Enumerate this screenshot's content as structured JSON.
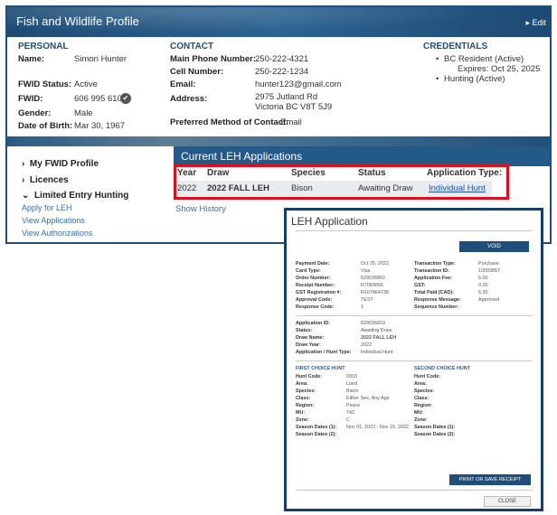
{
  "profile": {
    "title": "Fish and Wildlife Profile",
    "edit_label": "▸ Edit",
    "personal": {
      "heading": "PERSONAL",
      "name_label": "Name:",
      "name": "Simon Hunter",
      "fwid_status_label": "FWID Status:",
      "fwid_status": "Active",
      "fwid_label": "FWID:",
      "fwid": "606 995 610",
      "gender_label": "Gender:",
      "gender": "Male",
      "dob_label": "Date of Birth:",
      "dob": "Mar 30, 1967"
    },
    "contact": {
      "heading": "CONTACT",
      "main_phone_label": "Main Phone Number:",
      "main_phone": "250-222-4321",
      "cell_label": "Cell Number:",
      "cell": "250-222-1234",
      "email_label": "Email:",
      "email": "hunter123@gmail.com",
      "address_label": "Address:",
      "address_line1": "2975 Jutland Rd",
      "address_line2": "Victoria BC V8T 5J9",
      "preferred_label": "Preferred Method of Contact:",
      "preferred": "Email"
    },
    "credentials": {
      "heading": "CREDENTIALS",
      "item1": "BC Resident (Active)",
      "item1_expiry": "Expires: Oct 25, 2025",
      "item2": "Hunting (Active)"
    }
  },
  "nav": {
    "my_profile": "My FWID Profile",
    "licences": "Licences",
    "leh": "Limited Entry Hunting",
    "apply": "Apply for LEH",
    "view_apps": "View Applications",
    "view_auth": "View Authorizations"
  },
  "leh_table": {
    "heading": "Current LEH Applications",
    "headers": {
      "year": "Year",
      "draw": "Draw",
      "species": "Species",
      "status": "Status",
      "app_type": "Application Type:"
    },
    "row": {
      "year": "2022",
      "draw": "2022 FALL LEH",
      "species": "Bison",
      "status": "Awaiting Draw",
      "app_type": "Individual Hunt"
    },
    "show_history": "Show History"
  },
  "modal": {
    "title": "LEH Application",
    "void": "VOID",
    "payment": {
      "payment_date_label": "Payment Date:",
      "payment_date": "Oct 25, 2022",
      "card_type_label": "Card Type:",
      "card_type": "Visa",
      "order_number_label": "Order Number:",
      "order_number": "629036852",
      "receipt_number_label": "Receipt Number:",
      "receipt_number": "R7083856",
      "gst_reg_label": "GST Registration #:",
      "gst_reg": "R107864738",
      "approval_code_label": "Approval Code:",
      "approval_code": "TEST",
      "response_code_label": "Response Code:",
      "response_code": "1",
      "transaction_type_label": "Transaction Type:",
      "transaction_type": "Purchase",
      "transaction_id_label": "Transaction ID:",
      "transaction_id": "10003857",
      "application_fee_label": "Application Fee:",
      "application_fee": "6.00",
      "gst_label": "GST:",
      "gst": "0.30",
      "total_label": "Total Paid (CAD):",
      "total": "6.30",
      "response_message_label": "Response Message:",
      "response_message": "Approved",
      "sequence_label": "Sequence Number:",
      "sequence": ""
    },
    "application": {
      "app_id_label": "Application ID:",
      "app_id": "629036819",
      "status_label": "Status:",
      "status": "Awaiting Draw",
      "draw_name_label": "Draw Name:",
      "draw_name": "2022 FALL LEH",
      "draw_year_label": "Draw Year:",
      "draw_year": "2022",
      "hunt_type_label": "Application / Hunt Type:",
      "hunt_type": "Individual Hunt"
    },
    "first_choice": {
      "heading": "FIRST CHOICE HUNT",
      "hunt_code_label": "Hunt Code:",
      "hunt_code": "0003",
      "area_label": "Area:",
      "area": "Liard",
      "species_label": "Species:",
      "species": "Bison",
      "class_label": "Class:",
      "class": "Either Sex, Any Age",
      "region_label": "Region:",
      "region": "Peace",
      "mu_label": "MU:",
      "mu": "742",
      "zone_label": "Zone:",
      "zone": "C",
      "season1_label": "Season Dates (1):",
      "season1": "Nov 01, 2022 - Nov 15, 2022",
      "season2_label": "Season Dates (2):",
      "season2": ""
    },
    "second_choice": {
      "heading": "SECOND CHOICE HUNT",
      "hunt_code_label": "Hunt Code:",
      "area_label": "Area:",
      "species_label": "Species:",
      "class_label": "Class:",
      "region_label": "Region:",
      "mu_label": "MU:",
      "zone_label": "Zone:",
      "season1_label": "Season Dates (1):",
      "season2_label": "Season Dates (2):"
    },
    "print_label": "PRINT OR SAVE RECEIPT",
    "close_label": "CLOSE"
  }
}
